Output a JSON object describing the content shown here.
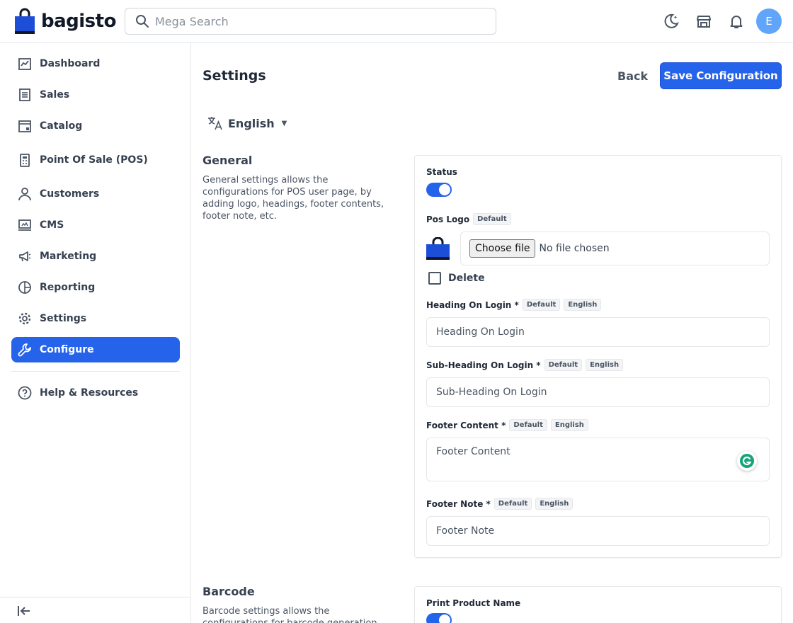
{
  "header": {
    "brand": "bagisto",
    "search_placeholder": "Mega Search",
    "avatar_initial": "E",
    "brand_color": "#2563eb"
  },
  "sidebar": {
    "items": [
      {
        "label": "Dashboard",
        "icon": "dashboard-icon"
      },
      {
        "label": "Sales",
        "icon": "sales-icon"
      },
      {
        "label": "Catalog",
        "icon": "catalog-icon"
      },
      {
        "label": "Point Of Sale (POS)",
        "icon": "pos-icon"
      },
      {
        "label": "Customers",
        "icon": "customers-icon"
      },
      {
        "label": "CMS",
        "icon": "cms-icon"
      },
      {
        "label": "Marketing",
        "icon": "marketing-icon"
      },
      {
        "label": "Reporting",
        "icon": "reporting-icon"
      },
      {
        "label": "Settings",
        "icon": "settings-icon"
      },
      {
        "label": "Configure",
        "icon": "configure-icon",
        "active": true
      },
      {
        "label": "Help & Resources",
        "icon": "help-icon"
      }
    ]
  },
  "page": {
    "title": "Settings",
    "back_label": "Back",
    "save_label": "Save Configuration",
    "locale": "English"
  },
  "general": {
    "title": "General",
    "description": "General settings allows the configurations for POS user page, by adding logo, headings, footer contents, footer note, etc.",
    "status_label": "Status",
    "status_on": true,
    "logo_label": "Pos Logo",
    "chip_default": "Default",
    "chip_locale": "English",
    "choose_file": "Choose file",
    "no_file": "No file chosen",
    "delete_label": "Delete",
    "heading_label": "Heading On Login *",
    "heading_placeholder": "Heading On Login",
    "subheading_label": "Sub-Heading On Login *",
    "subheading_placeholder": "Sub-Heading On Login",
    "footer_content_label": "Footer Content *",
    "footer_content_placeholder": "Footer Content",
    "footer_note_label": "Footer Note *",
    "footer_note_placeholder": "Footer Note"
  },
  "barcode": {
    "title": "Barcode",
    "description": "Barcode settings allows the configurations for barcode generation",
    "print_name_label": "Print Product Name",
    "print_name_on": true
  }
}
